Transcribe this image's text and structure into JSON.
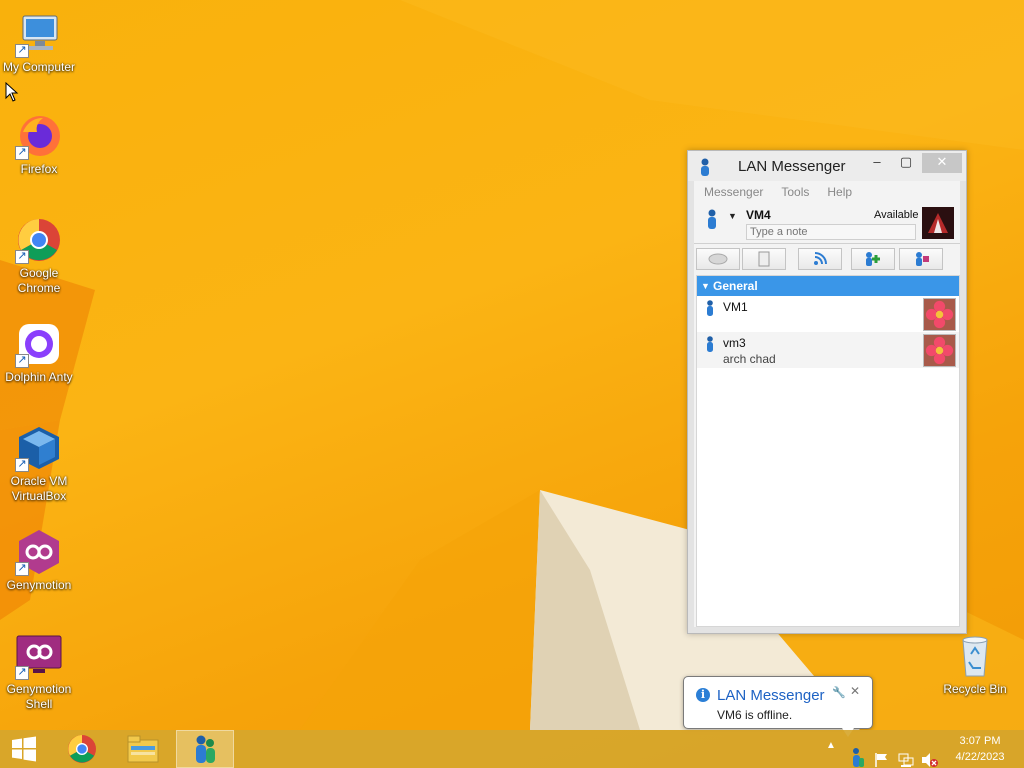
{
  "desktop": {
    "icons": [
      {
        "label": "My Computer",
        "icon": "computer-icon"
      },
      {
        "label": "Firefox",
        "icon": "firefox-icon"
      },
      {
        "label": "Google Chrome",
        "icon": "chrome-icon"
      },
      {
        "label": "Dolphin Anty",
        "icon": "dolphin-icon"
      },
      {
        "label": "Oracle VM VirtualBox",
        "icon": "virtualbox-icon"
      },
      {
        "label": "Genymotion",
        "icon": "genymotion-icon"
      },
      {
        "label": "Genymotion Shell",
        "icon": "genymotion-shell-icon"
      },
      {
        "label": "Recycle Bin",
        "icon": "recycle-bin-icon"
      }
    ]
  },
  "window": {
    "title": "LAN Messenger",
    "controls": {
      "minimize": "–",
      "maximize": "▢",
      "close": "✕"
    },
    "menu": [
      "Messenger",
      "Tools",
      "Help"
    ],
    "me": {
      "name": "VM4",
      "status": "Available",
      "note_placeholder": "Type a note"
    },
    "toolbar": [
      "chat-icon",
      "file-icon",
      "broadcast-icon",
      "add-contact-icon",
      "settings-icon"
    ],
    "group": {
      "name": "General"
    },
    "contacts": [
      {
        "name": "VM1",
        "note": ""
      },
      {
        "name": "vm3",
        "note": "arch chad"
      }
    ]
  },
  "notification": {
    "title": "LAN Messenger",
    "message": "VM6 is offline."
  },
  "taskbar": {
    "time": "3:07 PM",
    "date": "4/22/2023",
    "pinned": [
      "start-icon",
      "chrome-icon",
      "file-explorer-icon",
      "lan-messenger-icon"
    ],
    "tray": [
      "show-hidden-icon",
      "lan-messenger-tray-icon",
      "action-center-flag-icon",
      "network-icon",
      "volume-muted-icon"
    ]
  },
  "colors": {
    "wallpaper": "#f9b10c",
    "group_header": "#3a96e8",
    "notification_title": "#1d62c4"
  }
}
